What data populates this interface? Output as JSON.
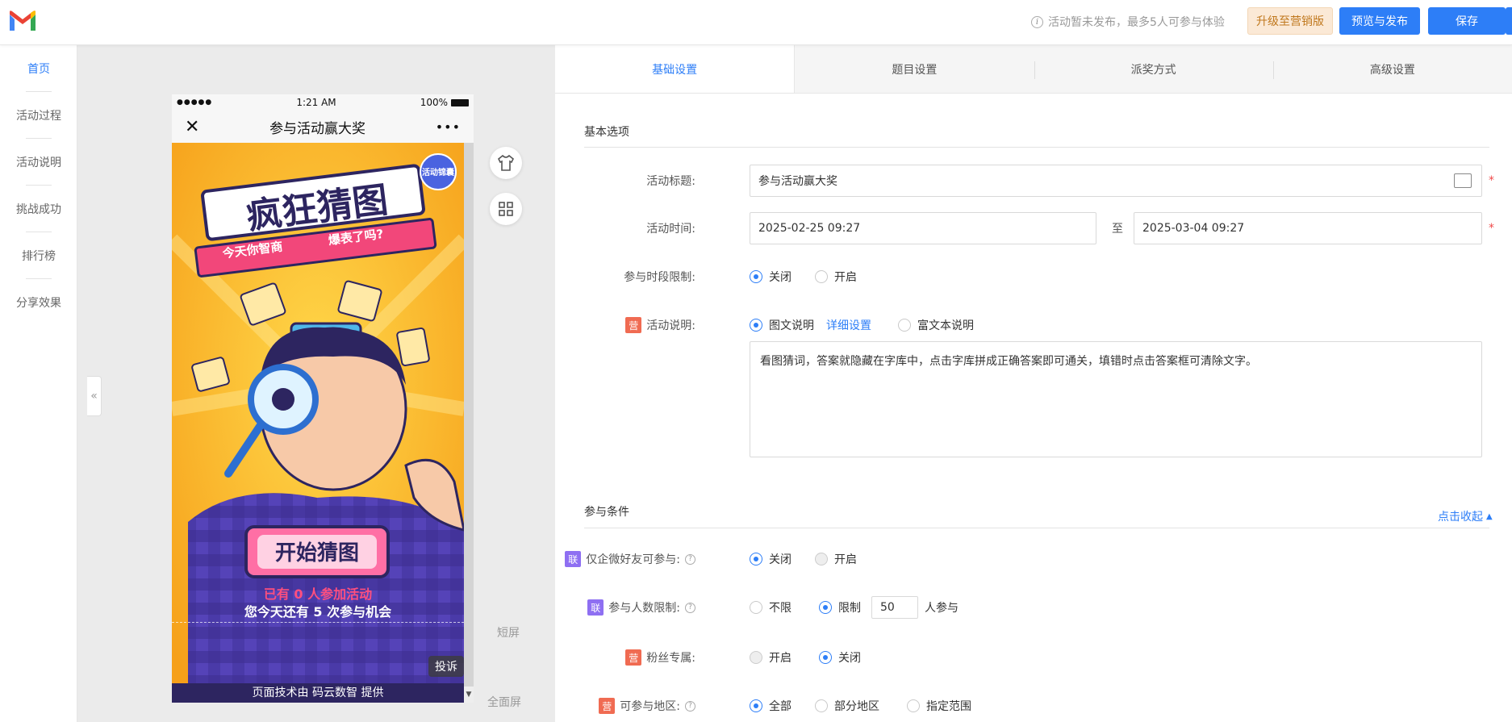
{
  "app": {
    "notice": "活动暂未发布，最多5人可参与体验",
    "upgrade_label": "升级至营销版",
    "preview_label": "预览与发布",
    "save_label": "保存"
  },
  "leftnav": {
    "items": [
      "首页",
      "活动过程",
      "活动说明",
      "挑战成功",
      "排行榜",
      "分享效果"
    ],
    "active_index": 0
  },
  "phone": {
    "signal": "●●●●●",
    "time": "1:21 AM",
    "battery": "100%",
    "title": "参与活动赢大奖",
    "poster_title": "疯狂猜图",
    "poster_subtitle_left": "今天你智商",
    "poster_subtitle_right": "爆表了吗?",
    "poster_badge": "活动锦囊",
    "start_button": "开始猜图",
    "participants_line": "已有 0 人参加活动",
    "chances_line": "您今天还有 5 次参与机会",
    "complaint": "投诉",
    "footer": "页面技术由 码云数智 提供",
    "short_screen": "短屏",
    "full_screen": "全面屏"
  },
  "tabs": [
    "基础设置",
    "题目设置",
    "派奖方式",
    "高级设置"
  ],
  "basic": {
    "section_title": "基本选项",
    "title_label": "活动标题:",
    "title_value": "参与活动赢大奖",
    "time_label": "活动时间:",
    "time_start": "2025-02-25 09:27",
    "time_to": "至",
    "time_end": "2025-03-04 09:27",
    "period_label": "参与时段限制:",
    "period_off": "关闭",
    "period_on": "开启",
    "desc_tag": "营",
    "desc_label": "活动说明:",
    "desc_opt1": "图文说明",
    "desc_detail": "详细设置",
    "desc_opt2": "富文本说明",
    "desc_text": "看图猜词，答案就隐藏在字库中，点击字库拼成正确答案即可通关，填错时点击答案框可清除文字。"
  },
  "conditions": {
    "section_title": "参与条件",
    "collapse": "点击收起",
    "wecom_tag": "联",
    "wecom_label": "仅企微好友可参与:",
    "wecom_off": "关闭",
    "wecom_on": "开启",
    "limit_tag": "联",
    "limit_label": "参与人数限制:",
    "limit_none": "不限",
    "limit_yes": "限制",
    "limit_value": "50",
    "limit_suffix": "人参与",
    "fans_tag": "营",
    "fans_label": "粉丝专属:",
    "fans_on": "开启",
    "fans_off": "关闭",
    "region_tag": "营",
    "region_label": "可参与地区:",
    "region_all": "全部",
    "region_part": "部分地区",
    "region_range": "指定范围"
  },
  "colors": {
    "accent": "#2d7ef7",
    "upgrade_bg": "#fbe9d6",
    "tag_ying": "#f06b52",
    "tag_lian": "#8e6ff2",
    "required": "#f04b4b"
  }
}
